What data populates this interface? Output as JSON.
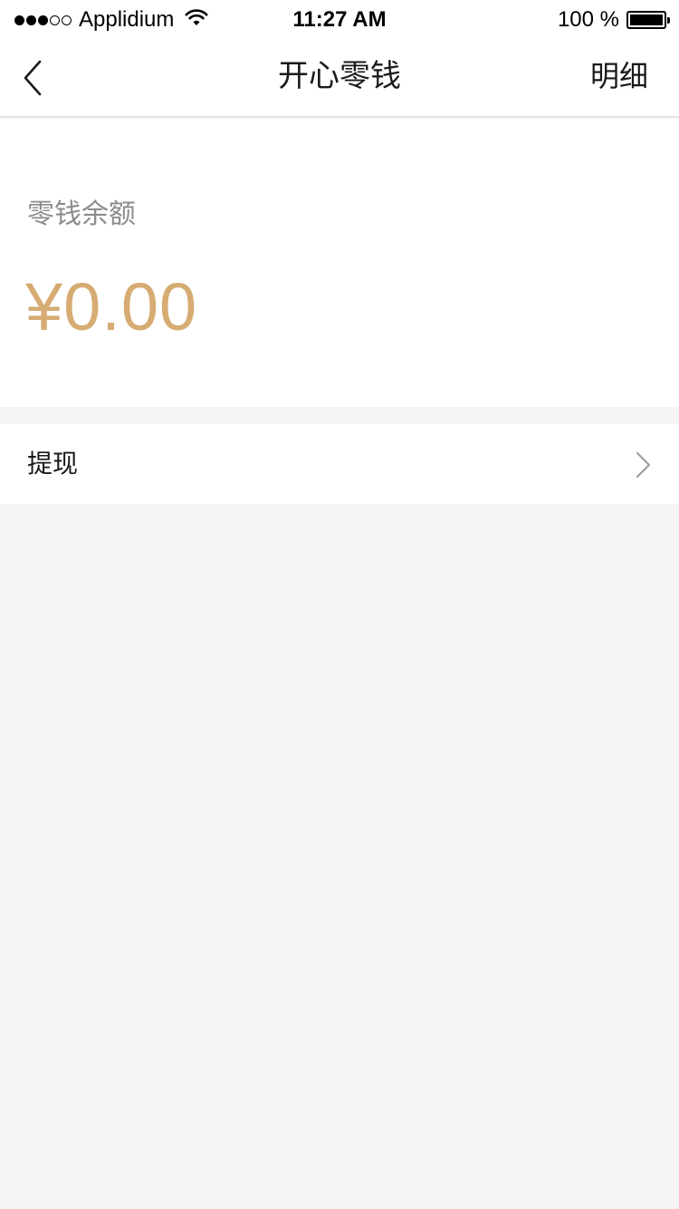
{
  "status_bar": {
    "carrier": "Applidium",
    "time": "11:27 AM",
    "battery_percent": "100 %",
    "signal_bars_filled": 3,
    "signal_bars_total": 5,
    "battery_level": 1.0
  },
  "nav": {
    "title": "开心零钱",
    "right_action": "明细"
  },
  "balance": {
    "label": "零钱余额",
    "amount": "¥0.00"
  },
  "menu": {
    "withdraw_label": "提现"
  },
  "colors": {
    "accent_gold": "#d6ac73",
    "background": "#f4f4f4",
    "label_gray": "#8c8c8c"
  }
}
